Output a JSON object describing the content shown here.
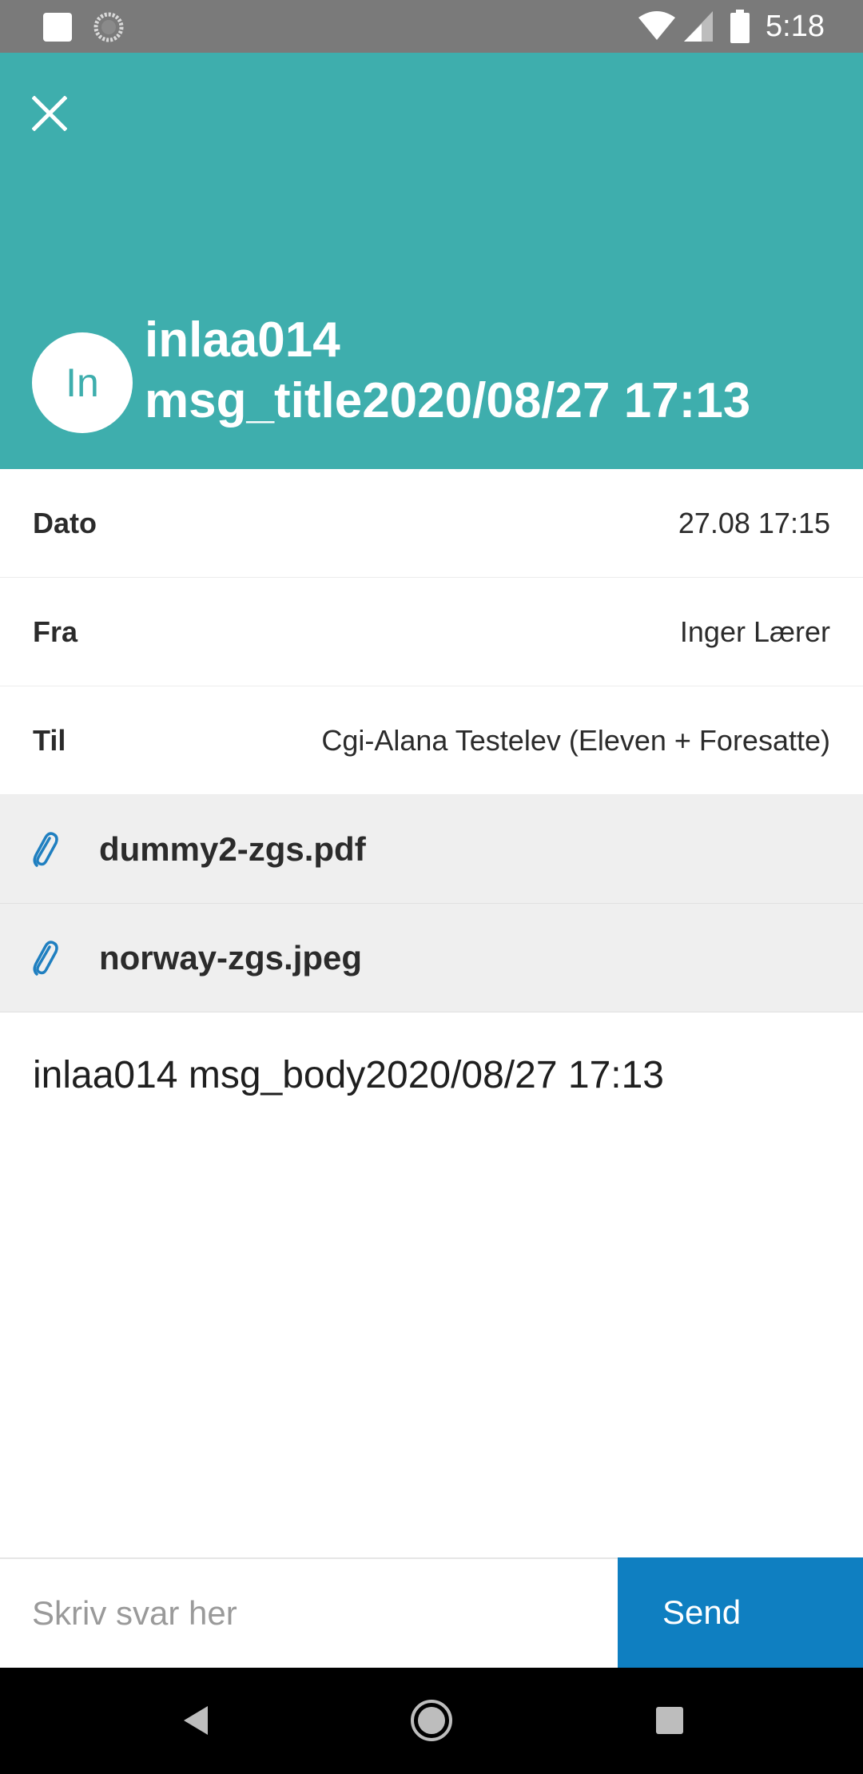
{
  "status_bar": {
    "time": "5:18",
    "icons": [
      "notification-square-icon",
      "loading-spinner-icon",
      "wifi-icon",
      "cellular-signal-icon",
      "battery-icon"
    ]
  },
  "header": {
    "close_icon": "close-icon",
    "avatar_initials": "In",
    "title_line1": "inlaa014",
    "title_line2": "msg_title2020/08/27 17:13",
    "background_color": "#3eaead"
  },
  "details": {
    "date": {
      "label": "Dato",
      "value": "27.08 17:15"
    },
    "from": {
      "label": "Fra",
      "value": "Inger Lærer"
    },
    "to": {
      "label": "Til",
      "value": "Cgi-Alana Testelev (Eleven + Foresatte)"
    }
  },
  "attachments": [
    {
      "name": "dummy2-zgs.pdf",
      "icon": "paperclip-icon"
    },
    {
      "name": "norway-zgs.jpeg",
      "icon": "paperclip-icon"
    }
  ],
  "body": {
    "text": "inlaa014 msg_body2020/08/27 17:13"
  },
  "reply": {
    "placeholder": "Skriv svar her",
    "value": "",
    "send_label": "Send",
    "send_color": "#0f7fc1"
  },
  "nav_bar": {
    "icons": [
      "back-triangle-icon",
      "home-circle-icon",
      "recent-apps-square-icon"
    ]
  }
}
